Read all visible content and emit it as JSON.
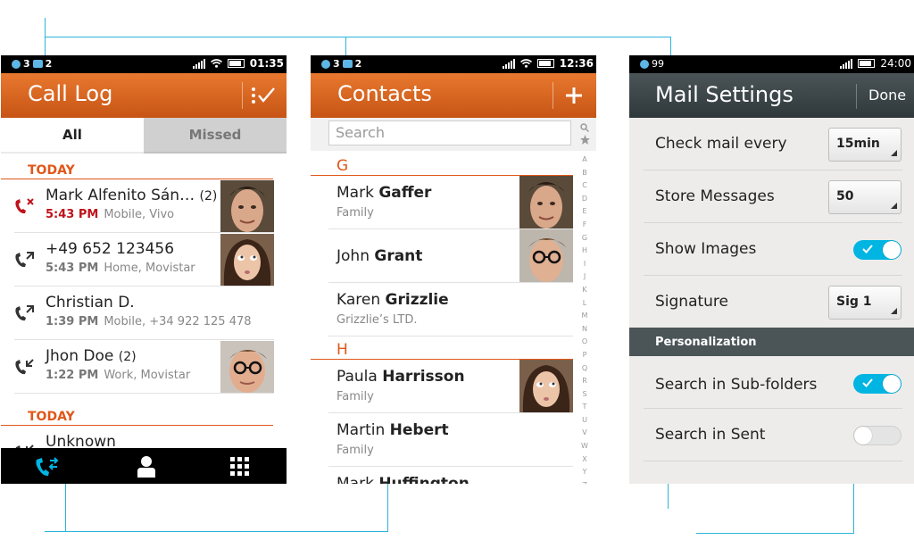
{
  "call_log": {
    "status": {
      "left_a": "3",
      "left_b": "2",
      "time": "01:35"
    },
    "title": "Call Log",
    "tabs": [
      "All",
      "Missed"
    ],
    "sections": [
      "TODAY",
      "TODAY"
    ],
    "calls": [
      {
        "name": "Mark Alfenito Sán…",
        "count": "(2)",
        "time": "5:43 PM",
        "detail": "Mobile, Vivo",
        "missed": true
      },
      {
        "name": "+49 652 123456",
        "count": "",
        "time": "5:43 PM",
        "detail": "Home, Movistar",
        "missed": false
      },
      {
        "name": "Christian D.",
        "count": "",
        "time": "1:39 PM",
        "detail": "Mobile, +34 922 125 478",
        "missed": false
      },
      {
        "name": "Jhon Doe",
        "count": "(2)",
        "time": "1:22 PM",
        "detail": "Work, Movistar",
        "missed": false
      },
      {
        "name": "Unknown",
        "count": "",
        "time": "",
        "detail": "",
        "missed": false
      }
    ],
    "icons": [
      "call-log-icon",
      "contacts-icon",
      "keypad-icon"
    ]
  },
  "contacts": {
    "status": {
      "left_a": "3",
      "left_b": "2",
      "time": "12:36"
    },
    "title": "Contacts",
    "search_placeholder": "Search",
    "index": [
      "A",
      "B",
      "C",
      "D",
      "E",
      "F",
      "G",
      "H",
      "I",
      "J",
      "K",
      "L",
      "M",
      "N",
      "O",
      "P",
      "Q",
      "R",
      "S",
      "T",
      "U",
      "V",
      "W",
      "X",
      "Y",
      "Z"
    ],
    "groups": [
      {
        "letter": "G",
        "items": [
          {
            "first": "Mark",
            "last": "Gaffer",
            "sub": "Family"
          },
          {
            "first": "John",
            "last": "Grant",
            "sub": ""
          },
          {
            "first": "Karen",
            "last": "Grizzlie",
            "sub": "Grizzlie’s LTD."
          }
        ]
      },
      {
        "letter": "H",
        "items": [
          {
            "first": "Paula",
            "last": "Harrisson",
            "sub": "Family"
          },
          {
            "first": "Martin",
            "last": "Hebert",
            "sub": "Family"
          },
          {
            "first": "Mark",
            "last": "Huffington",
            "sub": ""
          }
        ]
      }
    ]
  },
  "mail": {
    "status": {
      "left_a": "99",
      "time": "24:00"
    },
    "title": "Mail Settings",
    "done": "Done",
    "rows": [
      {
        "label": "Check mail every",
        "value": "15min"
      },
      {
        "label": "Store Messages",
        "value": "50"
      },
      {
        "label": "Show Images",
        "toggle": true
      },
      {
        "label": "Signature",
        "value": "Sig 1"
      }
    ],
    "personalization": "Personalization",
    "rows2": [
      {
        "label": "Search in Sub-folders",
        "toggle": true
      },
      {
        "label": "Search in Sent",
        "toggle": false
      }
    ]
  },
  "colors": {
    "accent": "#e0571a",
    "toggle_on": "#00b5e2",
    "guide": "#2ab4d9"
  }
}
